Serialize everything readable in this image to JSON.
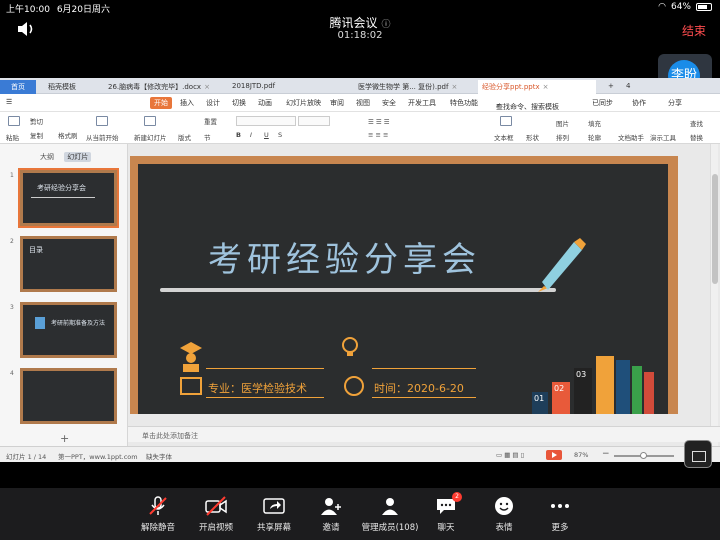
{
  "status": {
    "time": "上午10:00",
    "date": "6月20日周六",
    "battery": "64%"
  },
  "meeting": {
    "title": "腾讯会议",
    "duration": "01:18:02",
    "end_label": "结束"
  },
  "participant": {
    "avatar": "李盼",
    "name": "李盼"
  },
  "wps": {
    "tabs": [
      {
        "label": "首页"
      },
      {
        "label": "稻壳模板"
      },
      {
        "label": "26.脑病毒【修改完毕】.docx"
      },
      {
        "label": "2018JTD.pdf"
      },
      {
        "label": "医学微生物学 第... 复份).pdf"
      },
      {
        "label": "经验分享ppt.pptx"
      }
    ],
    "tab_count": "4",
    "menu": [
      "开始",
      "插入",
      "设计",
      "切换",
      "动画",
      "幻灯片放映",
      "审阅",
      "视图",
      "安全",
      "开发工具",
      "特色功能"
    ],
    "search": "查找命令、搜索模板",
    "sync": "已同步",
    "collab": "协作",
    "share": "分享",
    "toolbar": {
      "paste": "粘贴",
      "cut": "剪切",
      "copy": "复制",
      "format_painter": "格式刷",
      "from_current": "从当前开始",
      "new_slide": "新建幻灯片",
      "layout": "版式",
      "section": "节",
      "reset": "重置",
      "textbox": "文本框",
      "shape": "形状",
      "arrange": "排列",
      "picture": "图片",
      "fill": "填充",
      "outline": "轮廓",
      "doc_helper": "文档助手",
      "present_tool": "演示工具",
      "find": "查找",
      "replace": "替换"
    },
    "left_tabs": {
      "outline": "大纲",
      "slides": "幻灯片"
    },
    "thumbs": [
      {
        "num": "1",
        "title": "考研经验分享会"
      },
      {
        "num": "2",
        "title": "目录"
      },
      {
        "num": "3",
        "title": "考研前期准备及方法"
      },
      {
        "num": "4",
        "title": ""
      }
    ],
    "notes": "单击此处添加备注",
    "statusbar": {
      "slide_info": "幻灯片 1 / 14",
      "theme": "第一PPT，www.1ppt.com",
      "missing_font": "缺失字体",
      "zoom": "87%"
    }
  },
  "slide": {
    "title": "考研经验分享会",
    "major": "专业：医学检验技术",
    "time": "时间：2020-6-20",
    "bars": [
      "01",
      "02",
      "03"
    ]
  },
  "toolbar": [
    {
      "label": "解除静音",
      "icon": "mic-muted-icon"
    },
    {
      "label": "开启视频",
      "icon": "video-off-icon"
    },
    {
      "label": "共享屏幕",
      "icon": "share-screen-icon"
    },
    {
      "label": "邀请",
      "icon": "invite-icon"
    },
    {
      "label": "管理成员(108)",
      "icon": "members-icon"
    },
    {
      "label": "聊天",
      "icon": "chat-icon",
      "badge": "2"
    },
    {
      "label": "表情",
      "icon": "emoji-icon"
    },
    {
      "label": "更多",
      "icon": "more-icon"
    }
  ]
}
